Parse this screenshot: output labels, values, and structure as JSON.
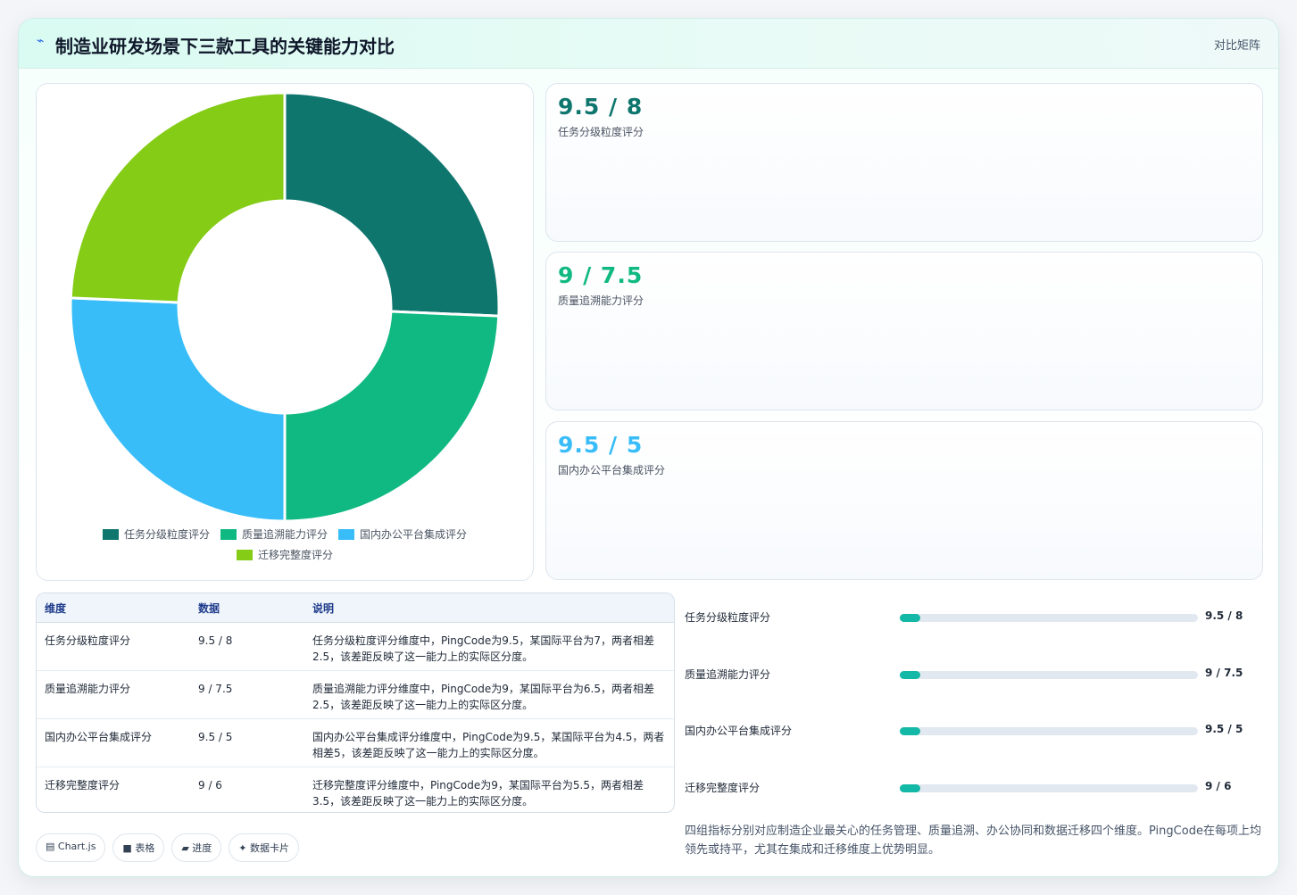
{
  "header": {
    "icon": "sparkle-icon",
    "title": "制造业研发场景下三款工具的关键能力对比",
    "tag": "对比矩阵"
  },
  "chart_data": {
    "type": "doughnut",
    "categories": [
      "任务分级粒度评分",
      "质量追溯能力评分",
      "国内办公平台集成评分",
      "迁移完整度评分"
    ],
    "values": [
      9.5,
      9,
      9.5,
      9
    ],
    "colors": [
      "#0f766e",
      "#10b981",
      "#38bdf8",
      "#84cc16"
    ]
  },
  "stats": [
    {
      "value": "9.5 / 8",
      "label": "任务分级粒度评分",
      "color": "#0f766e"
    },
    {
      "value": "9 / 7.5",
      "label": "质量追溯能力评分",
      "color": "#10b981"
    },
    {
      "value": "9.5 / 5",
      "label": "国内办公平台集成评分",
      "color": "#38bdf8"
    }
  ],
  "table": {
    "headers": [
      "维度",
      "数据",
      "说明"
    ],
    "rows": [
      [
        "任务分级粒度评分",
        "9.5 / 8",
        "任务分级粒度评分维度中，PingCode为9.5，某国际平台为7，两者相差2.5，该差距反映了这一能力上的实际区分度。"
      ],
      [
        "质量追溯能力评分",
        "9 / 7.5",
        "质量追溯能力评分维度中，PingCode为9，某国际平台为6.5，两者相差2.5，该差距反映了这一能力上的实际区分度。"
      ],
      [
        "国内办公平台集成评分",
        "9.5 / 5",
        "国内办公平台集成评分维度中，PingCode为9.5，某国际平台为4.5，两者相差5，该差距反映了这一能力上的实际区分度。"
      ],
      [
        "迁移完整度评分",
        "9 / 6",
        "迁移完整度评分维度中，PingCode为9，某国际平台为5.5，两者相差3.5，该差距反映了这一能力上的实际区分度。"
      ]
    ]
  },
  "bars": [
    {
      "label": "任务分级粒度评分",
      "value": "9.5 / 8",
      "progress": 0.07
    },
    {
      "label": "质量追溯能力评分",
      "value": "9 / 7.5",
      "progress": 0.07
    },
    {
      "label": "国内办公平台集成评分",
      "value": "9.5 / 5",
      "progress": 0.07
    },
    {
      "label": "迁移完整度评分",
      "value": "9 / 6",
      "progress": 0.07
    }
  ],
  "note": "四组指标分别对应制造企业最关心的任务管理、质量追溯、办公协同和数据迁移四个维度。PingCode在每项上均领先或持平，尤其在集成和迁移维度上优势明显。",
  "chips": [
    {
      "icon": "chart-icon",
      "glyph": "▤",
      "label": "Chart.js"
    },
    {
      "icon": "table-icon",
      "glyph": "■",
      "label": "表格"
    },
    {
      "icon": "progress-icon",
      "glyph": "▰",
      "label": "进度"
    },
    {
      "icon": "card-icon",
      "glyph": "✦",
      "label": "数据卡片"
    }
  ]
}
